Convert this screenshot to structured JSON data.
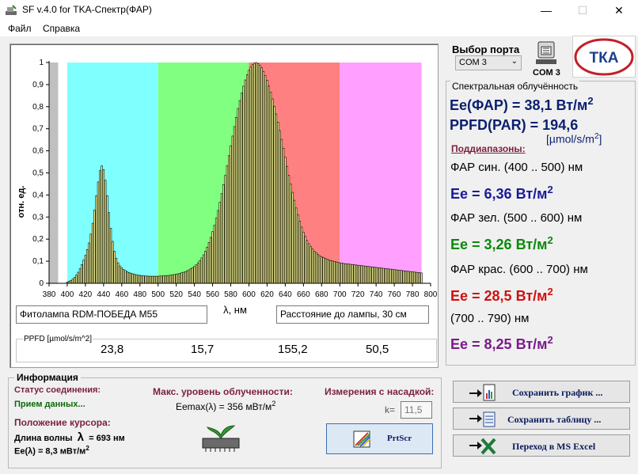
{
  "window": {
    "title": "SF v.4.0 for TKA-Спектр(ФАР)",
    "minimize": "—",
    "maximize": "☐",
    "close": "✕"
  },
  "menu": {
    "file": "Файл",
    "help": "Справка"
  },
  "port": {
    "label": "Выбор порта",
    "selected": "COM 3",
    "device_label": "COM 3",
    "logo_text": "ТКА"
  },
  "chart": {
    "ylabel": "отн. ед.",
    "xlabel": "λ, нм",
    "lamp_name": "Фитолампа RDM-ПОБЕДА М55",
    "distance": "Расстояние до лампы,  30 см",
    "y_ticks": [
      "0",
      "0,1",
      "0,2",
      "0,3",
      "0,4",
      "0,5",
      "0,6",
      "0,7",
      "0,8",
      "0,9",
      "1"
    ],
    "x_ticks": [
      "380",
      "400",
      "420",
      "440",
      "460",
      "480",
      "500",
      "520",
      "540",
      "560",
      "580",
      "600",
      "620",
      "640",
      "660",
      "680",
      "700",
      "720",
      "740",
      "760",
      "780",
      "800"
    ],
    "bands": [
      {
        "from": 380,
        "to": 390,
        "color": "#c0c0c0"
      },
      {
        "from": 390,
        "to": 400,
        "color": "#ffffff"
      },
      {
        "from": 400,
        "to": 500,
        "color": "#80ffff"
      },
      {
        "from": 500,
        "to": 600,
        "color": "#80ff80"
      },
      {
        "from": 600,
        "to": 700,
        "color": "#ff8080"
      },
      {
        "from": 700,
        "to": 790,
        "color": "#ff9fff"
      }
    ]
  },
  "chart_data": {
    "type": "bar",
    "xlabel": "λ, нм",
    "ylabel": "отн. ед.",
    "xlim": [
      380,
      800
    ],
    "ylim": [
      0,
      1
    ],
    "bar_width_nm": 2,
    "x": [
      400,
      402,
      404,
      406,
      408,
      410,
      412,
      414,
      416,
      418,
      420,
      422,
      424,
      426,
      428,
      430,
      432,
      434,
      436,
      438,
      440,
      442,
      444,
      446,
      448,
      450,
      452,
      454,
      456,
      458,
      460,
      462,
      464,
      466,
      468,
      470,
      472,
      474,
      476,
      478,
      480,
      482,
      484,
      486,
      488,
      490,
      492,
      494,
      496,
      498,
      500,
      502,
      504,
      506,
      508,
      510,
      512,
      514,
      516,
      518,
      520,
      522,
      524,
      526,
      528,
      530,
      532,
      534,
      536,
      538,
      540,
      542,
      544,
      546,
      548,
      550,
      552,
      554,
      556,
      558,
      560,
      562,
      564,
      566,
      568,
      570,
      572,
      574,
      576,
      578,
      580,
      582,
      584,
      586,
      588,
      590,
      592,
      594,
      596,
      598,
      600,
      602,
      604,
      606,
      608,
      610,
      612,
      614,
      616,
      618,
      620,
      622,
      624,
      626,
      628,
      630,
      632,
      634,
      636,
      638,
      640,
      642,
      644,
      646,
      648,
      650,
      652,
      654,
      656,
      658,
      660,
      662,
      664,
      666,
      668,
      670,
      672,
      674,
      676,
      678,
      680,
      682,
      684,
      686,
      688,
      690,
      692,
      694,
      696,
      698,
      700,
      702,
      704,
      706,
      708,
      710,
      712,
      714,
      716,
      718,
      720,
      722,
      724,
      726,
      728,
      730,
      732,
      734,
      736,
      738,
      740,
      742,
      744,
      746,
      748,
      750,
      752,
      754,
      756,
      758,
      760,
      762,
      764,
      766,
      768,
      770,
      772,
      774,
      776,
      778,
      780,
      782,
      784,
      786,
      788,
      790
    ],
    "values": [
      0.006,
      0.009,
      0.013,
      0.019,
      0.027,
      0.037,
      0.05,
      0.066,
      0.085,
      0.105,
      0.127,
      0.153,
      0.183,
      0.223,
      0.272,
      0.331,
      0.397,
      0.459,
      0.51,
      0.532,
      0.515,
      0.467,
      0.397,
      0.32,
      0.249,
      0.19,
      0.145,
      0.114,
      0.093,
      0.079,
      0.07,
      0.063,
      0.058,
      0.053,
      0.049,
      0.046,
      0.043,
      0.041,
      0.039,
      0.037,
      0.036,
      0.035,
      0.034,
      0.033,
      0.033,
      0.032,
      0.032,
      0.032,
      0.032,
      0.032,
      0.032,
      0.033,
      0.033,
      0.034,
      0.034,
      0.035,
      0.036,
      0.037,
      0.038,
      0.04,
      0.041,
      0.043,
      0.045,
      0.048,
      0.05,
      0.053,
      0.057,
      0.061,
      0.066,
      0.071,
      0.077,
      0.084,
      0.093,
      0.103,
      0.115,
      0.129,
      0.145,
      0.164,
      0.185,
      0.208,
      0.234,
      0.263,
      0.295,
      0.33,
      0.367,
      0.406,
      0.447,
      0.489,
      0.533,
      0.578,
      0.623,
      0.667,
      0.71,
      0.752,
      0.792,
      0.828,
      0.862,
      0.893,
      0.921,
      0.945,
      0.965,
      0.979,
      0.99,
      0.997,
      1.0,
      0.995,
      0.988,
      0.976,
      0.96,
      0.941,
      0.919,
      0.894,
      0.866,
      0.835,
      0.802,
      0.767,
      0.73,
      0.692,
      0.652,
      0.612,
      0.571,
      0.53,
      0.489,
      0.45,
      0.412,
      0.376,
      0.341,
      0.31,
      0.281,
      0.255,
      0.232,
      0.212,
      0.194,
      0.179,
      0.166,
      0.155,
      0.146,
      0.138,
      0.131,
      0.125,
      0.12,
      0.116,
      0.112,
      0.109,
      0.106,
      0.103,
      0.101,
      0.099,
      0.097,
      0.095,
      0.093,
      0.092,
      0.09,
      0.089,
      0.088,
      0.087,
      0.086,
      0.085,
      0.084,
      0.083,
      0.082,
      0.081,
      0.08,
      0.079,
      0.078,
      0.077,
      0.076,
      0.075,
      0.074,
      0.073,
      0.072,
      0.071,
      0.07,
      0.069,
      0.068,
      0.067,
      0.066,
      0.065,
      0.064,
      0.063,
      0.062,
      0.061,
      0.06,
      0.059,
      0.058,
      0.057,
      0.056,
      0.055,
      0.054,
      0.053,
      0.052,
      0.051,
      0.05,
      0.049,
      0.048,
      0.047,
      0.046
    ]
  },
  "ppfd": {
    "label": "PPFD [µmol/s/m^2]",
    "values": [
      {
        "value": "23,8",
        "color": "#1f2f8a"
      },
      {
        "value": "15,7",
        "color": "#33cc33"
      },
      {
        "value": "155,2",
        "color": "#b01818"
      },
      {
        "value": "50,5",
        "color": "#6b1a6b"
      }
    ]
  },
  "spectral": {
    "group_label": "Спектральная облучённость",
    "ee_far": "Ее(ФАР) = 38,1 Вт/м",
    "ppfd_par": "PPFD(PAR) = 194,6",
    "ppfd_unit": "[µmol/s/m",
    "ppfd_unit_close": "]",
    "sup2": "2",
    "subranges_label": "Поддиапазоны:",
    "bands": [
      {
        "name": "ФАР син. (400 .. 500) нм",
        "value": "Ee = 6,36 Вт/м",
        "color": "#1a1a9a"
      },
      {
        "name": "ФАР зел. (500 .. 600) нм",
        "value": "Ee = 3,26 Вт/м",
        "color": "#0a8a0a"
      },
      {
        "name": "ФАР крас. (600 .. 700) нм",
        "value": "Ee = 28,5 Вт/м",
        "color": "#d01010"
      },
      {
        "name": "(700 .. 790) нм",
        "value": "Ee = 8,25 Вт/м",
        "color": "#7a1a8a"
      }
    ]
  },
  "info": {
    "group_label": "Информация",
    "status_label": "Статус соединения:",
    "status_value": "Прием данных...",
    "cursor_label": "Положение курсора:",
    "wavelength_label": "Длина волны",
    "lambda": "λ",
    "wavelength_value": "= 693 нм",
    "ee_cursor": "Ee(λ) = 8,3 мВт/м",
    "max_label": "Макс. уровень облученности:",
    "emax": "Eemax(λ) = 356 мВт/м",
    "attach_label": "Измерения с насадкой:",
    "k_label": "k=",
    "k_value": "11,5",
    "prtscr": "PrtScr"
  },
  "buttons": {
    "save_chart": "Сохранить график ...",
    "save_table": "Сохранить таблицу ...",
    "excel": "Переход в MS Excel"
  },
  "colors": {
    "bar_fill": "#ffff99",
    "bar_stroke": "#000000"
  }
}
